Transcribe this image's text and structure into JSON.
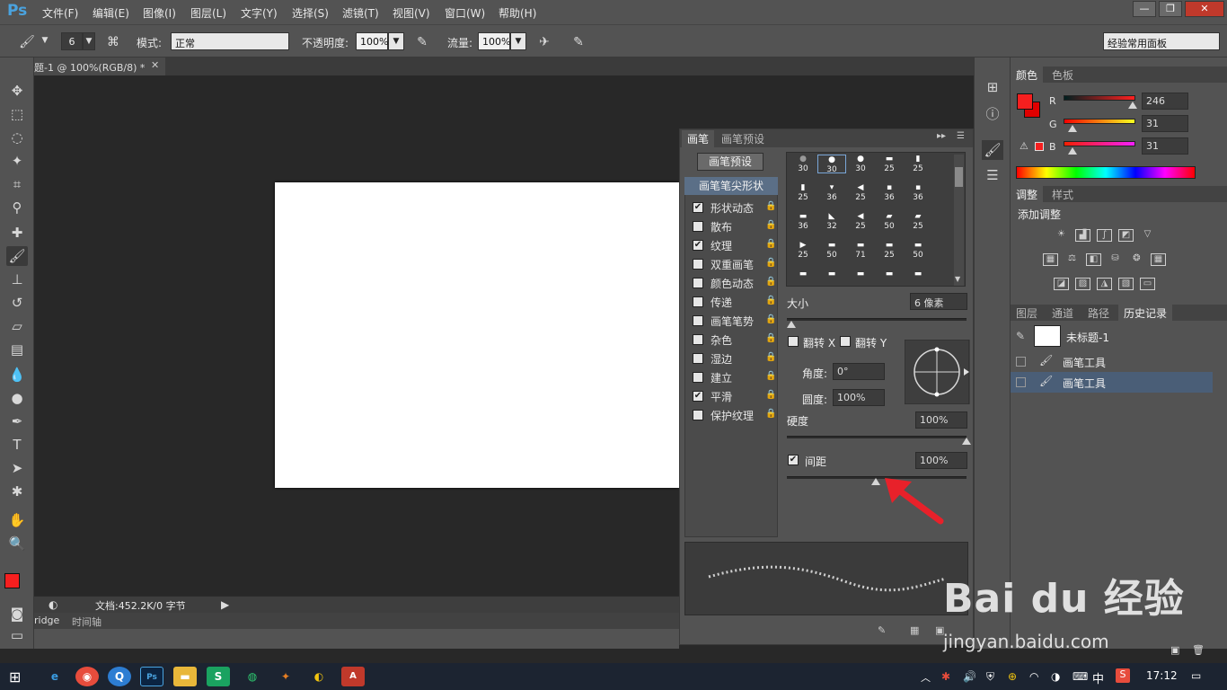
{
  "app": {
    "logo": "Ps"
  },
  "menu": [
    "文件(F)",
    "编辑(E)",
    "图像(I)",
    "图层(L)",
    "文字(Y)",
    "选择(S)",
    "滤镜(T)",
    "视图(V)",
    "窗口(W)",
    "帮助(H)"
  ],
  "window_buttons": [
    "—",
    "❐",
    "✕"
  ],
  "options": {
    "brush_size": "6",
    "mode_label": "模式:",
    "mode_value": "正常",
    "opacity_label": "不透明度:",
    "opacity_value": "100%",
    "flow_label": "流量:",
    "flow_value": "100%",
    "workspace": "经验常用面板"
  },
  "document": {
    "tab_title": "题-1 @ 100%(RGB/8) *",
    "status": "文档:452.2K/0 字节",
    "bottom_tabs": [
      "ridge",
      "时间轴"
    ]
  },
  "color_panel": {
    "tabs": [
      "颜色",
      "色板"
    ],
    "channels": [
      {
        "label": "R",
        "value": "246"
      },
      {
        "label": "G",
        "value": "31"
      },
      {
        "label": "B",
        "value": "31"
      }
    ],
    "fg_color": "#f61f1f",
    "bg_color": "#e00000"
  },
  "adjust_panel": {
    "tabs": [
      "调整",
      "样式"
    ],
    "title": "添加调整"
  },
  "history_panel": {
    "tabs": [
      "图层",
      "通道",
      "路径",
      "历史记录"
    ],
    "snapshot": "未标题-1",
    "steps": [
      "画笔工具",
      "画笔工具"
    ]
  },
  "brush_panel": {
    "tabs": [
      "画笔",
      "画笔预设"
    ],
    "preset_button": "画笔预设",
    "tip_shape": "画笔笔尖形状",
    "options": [
      {
        "label": "形状动态",
        "checked": true
      },
      {
        "label": "散布",
        "checked": false
      },
      {
        "label": "纹理",
        "checked": true
      },
      {
        "label": "双重画笔",
        "checked": false
      },
      {
        "label": "颜色动态",
        "checked": false
      },
      {
        "label": "传递",
        "checked": false
      },
      {
        "label": "画笔笔势",
        "checked": false
      },
      {
        "label": "杂色",
        "checked": false
      },
      {
        "label": "湿边",
        "checked": false
      },
      {
        "label": "建立",
        "checked": false
      },
      {
        "label": "平滑",
        "checked": true
      },
      {
        "label": "保护纹理",
        "checked": false
      }
    ],
    "tip_sizes": [
      [
        "30",
        "30",
        "30",
        "25",
        "25"
      ],
      [
        "25",
        "36",
        "25",
        "36",
        "36"
      ],
      [
        "36",
        "32",
        "25",
        "50",
        "25"
      ],
      [
        "25",
        "50",
        "71",
        "25",
        "50"
      ],
      [
        "",
        "",
        "",
        "",
        ""
      ]
    ],
    "size_label": "大小",
    "size_value": "6 像素",
    "flip_x": "翻转 X",
    "flip_y": "翻转 Y",
    "angle_label": "角度:",
    "angle_value": "0°",
    "roundness_label": "圆度:",
    "roundness_value": "100%",
    "hardness_label": "硬度",
    "hardness_value": "100%",
    "spacing_label": "间距",
    "spacing_value": "100%",
    "spacing_checked": true
  },
  "watermark": {
    "brand": "Bai du 经验",
    "url": "jingyan.baidu.com"
  },
  "taskbar": {
    "time": "17:12",
    "ime": "中"
  }
}
